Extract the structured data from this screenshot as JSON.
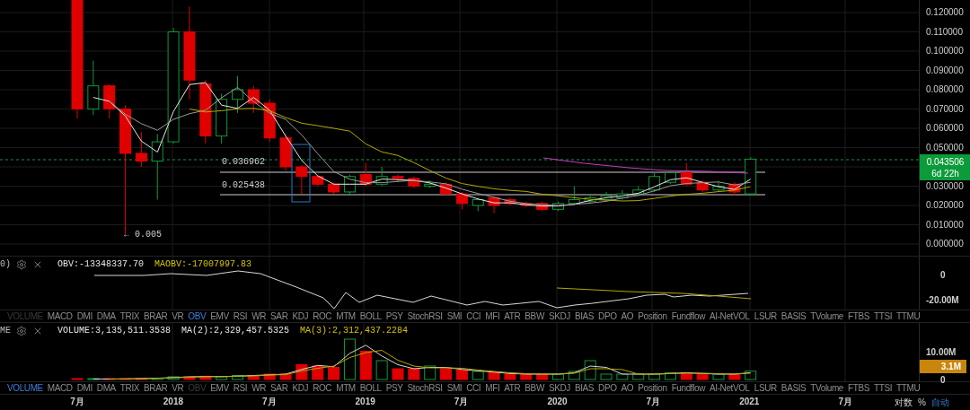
{
  "price_axis": {
    "ticks": [
      "0.120000",
      "0.110000",
      "0.100000",
      "0.090000",
      "0.080000",
      "0.070000",
      "0.060000",
      "0.050000",
      "0.030000",
      "0.020000",
      "0.010000",
      "0.000000"
    ],
    "current_price": "0.043506",
    "countdown": "6d 22h"
  },
  "annotations": {
    "level_upper": "0.036962",
    "level_lower": "0.025438",
    "low_marker": "← 0.005"
  },
  "obv_panel": {
    "legend_prefix": "0)",
    "obv": "OBV:-13348337.70",
    "maobv": "MAOBV:-17007997.83",
    "axis": [
      "0",
      "-20.00M"
    ],
    "tabs": [
      {
        "label": "VOLUME",
        "selected": false,
        "disabled": true
      },
      {
        "label": "MACD",
        "selected": false,
        "disabled": false
      },
      {
        "label": "DMI",
        "selected": false,
        "disabled": false
      },
      {
        "label": "DMA",
        "selected": false,
        "disabled": false
      },
      {
        "label": "TRIX",
        "selected": false,
        "disabled": false
      },
      {
        "label": "BRAR",
        "selected": false,
        "disabled": false
      },
      {
        "label": "VR",
        "selected": false,
        "disabled": false
      },
      {
        "label": "OBV",
        "selected": true,
        "disabled": false
      },
      {
        "label": "EMV",
        "selected": false,
        "disabled": false
      },
      {
        "label": "RSI",
        "selected": false,
        "disabled": false
      },
      {
        "label": "WR",
        "selected": false,
        "disabled": false
      },
      {
        "label": "SAR",
        "selected": false,
        "disabled": false
      },
      {
        "label": "KDJ",
        "selected": false,
        "disabled": false
      },
      {
        "label": "ROC",
        "selected": false,
        "disabled": false
      },
      {
        "label": "MTM",
        "selected": false,
        "disabled": false
      },
      {
        "label": "BOLL",
        "selected": false,
        "disabled": false
      },
      {
        "label": "PSY",
        "selected": false,
        "disabled": false
      },
      {
        "label": "StochRSI",
        "selected": false,
        "disabled": false
      },
      {
        "label": "SMI",
        "selected": false,
        "disabled": false
      },
      {
        "label": "CCI",
        "selected": false,
        "disabled": false
      },
      {
        "label": "MFI",
        "selected": false,
        "disabled": false
      },
      {
        "label": "ATR",
        "selected": false,
        "disabled": false
      },
      {
        "label": "BBW",
        "selected": false,
        "disabled": false
      },
      {
        "label": "SKDJ",
        "selected": false,
        "disabled": false
      },
      {
        "label": "BIAS",
        "selected": false,
        "disabled": false
      },
      {
        "label": "DPO",
        "selected": false,
        "disabled": false
      },
      {
        "label": "AO",
        "selected": false,
        "disabled": false
      },
      {
        "label": "Position",
        "selected": false,
        "disabled": false
      },
      {
        "label": "Fundflow",
        "selected": false,
        "disabled": false
      },
      {
        "label": "AI-NetVOL",
        "selected": false,
        "disabled": false
      },
      {
        "label": "LSUR",
        "selected": false,
        "disabled": false
      },
      {
        "label": "BASIS",
        "selected": false,
        "disabled": false
      },
      {
        "label": "TVolume",
        "selected": false,
        "disabled": false
      },
      {
        "label": "FTBS",
        "selected": false,
        "disabled": false
      },
      {
        "label": "TTSI",
        "selected": false,
        "disabled": false
      },
      {
        "label": "TTMU",
        "selected": false,
        "disabled": false
      }
    ]
  },
  "volume_panel": {
    "legend_prefix": "ME",
    "volume": "VOLUME:3,135,511.3538",
    "ma2": "MA(2):2,329,457.5325",
    "ma3": "MA(3):2,312,437.2284",
    "axis": [
      "10.00M",
      "0"
    ],
    "current_volume": "3.1M",
    "tabs": [
      {
        "label": "VOLUME",
        "selected": true,
        "disabled": false
      },
      {
        "label": "MACD",
        "selected": false,
        "disabled": false
      },
      {
        "label": "DMI",
        "selected": false,
        "disabled": false
      },
      {
        "label": "DMA",
        "selected": false,
        "disabled": false
      },
      {
        "label": "TRIX",
        "selected": false,
        "disabled": false
      },
      {
        "label": "BRAR",
        "selected": false,
        "disabled": false
      },
      {
        "label": "VR",
        "selected": false,
        "disabled": false
      },
      {
        "label": "OBV",
        "selected": false,
        "disabled": true
      },
      {
        "label": "EMV",
        "selected": false,
        "disabled": false
      },
      {
        "label": "RSI",
        "selected": false,
        "disabled": false
      },
      {
        "label": "WR",
        "selected": false,
        "disabled": false
      },
      {
        "label": "SAR",
        "selected": false,
        "disabled": false
      },
      {
        "label": "KDJ",
        "selected": false,
        "disabled": false
      },
      {
        "label": "ROC",
        "selected": false,
        "disabled": false
      },
      {
        "label": "MTM",
        "selected": false,
        "disabled": false
      },
      {
        "label": "BOLL",
        "selected": false,
        "disabled": false
      },
      {
        "label": "PSY",
        "selected": false,
        "disabled": false
      },
      {
        "label": "StochRSI",
        "selected": false,
        "disabled": false
      },
      {
        "label": "SMI",
        "selected": false,
        "disabled": false
      },
      {
        "label": "CCI",
        "selected": false,
        "disabled": false
      },
      {
        "label": "MFI",
        "selected": false,
        "disabled": false
      },
      {
        "label": "ATR",
        "selected": false,
        "disabled": false
      },
      {
        "label": "BBW",
        "selected": false,
        "disabled": false
      },
      {
        "label": "SKDJ",
        "selected": false,
        "disabled": false
      },
      {
        "label": "BIAS",
        "selected": false,
        "disabled": false
      },
      {
        "label": "DPO",
        "selected": false,
        "disabled": false
      },
      {
        "label": "AO",
        "selected": false,
        "disabled": false
      },
      {
        "label": "Position",
        "selected": false,
        "disabled": false
      },
      {
        "label": "Fundflow",
        "selected": false,
        "disabled": false
      },
      {
        "label": "AI-NetVOL",
        "selected": false,
        "disabled": false
      },
      {
        "label": "LSUR",
        "selected": false,
        "disabled": false
      },
      {
        "label": "BASIS",
        "selected": false,
        "disabled": false
      },
      {
        "label": "TVolume",
        "selected": false,
        "disabled": false
      },
      {
        "label": "FTBS",
        "selected": false,
        "disabled": false
      },
      {
        "label": "TTSI",
        "selected": false,
        "disabled": false
      },
      {
        "label": "TTMU",
        "selected": false,
        "disabled": false
      }
    ]
  },
  "time_axis": {
    "labels": [
      "7月",
      "2018",
      "7月",
      "2019",
      "7月",
      "2020",
      "7月",
      "2021",
      "7月"
    ],
    "controls": [
      {
        "label": "对数",
        "selected": false
      },
      {
        "label": "%",
        "selected": false
      },
      {
        "label": "自动",
        "selected": true
      }
    ]
  }
}
